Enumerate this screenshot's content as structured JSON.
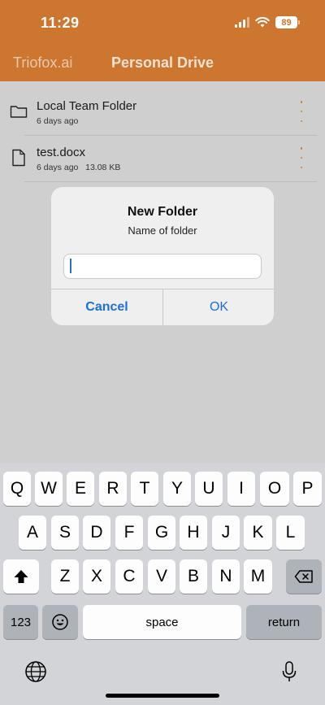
{
  "status_bar": {
    "time": "11:29",
    "battery": "89"
  },
  "nav": {
    "back_label": "Triofox.ai",
    "title": "Personal Drive"
  },
  "files": [
    {
      "name": "Local Team Folder",
      "meta": "6 days ago",
      "icon": "folder-icon"
    },
    {
      "name": "test.docx",
      "meta": "6 days ago   13.08 KB",
      "icon": "document-icon"
    }
  ],
  "dialog": {
    "title": "New Folder",
    "message": "Name of folder",
    "input_value": "",
    "cancel_label": "Cancel",
    "ok_label": "OK"
  },
  "keyboard": {
    "row1": [
      "Q",
      "W",
      "E",
      "R",
      "T",
      "Y",
      "U",
      "I",
      "O",
      "P"
    ],
    "row2": [
      "A",
      "S",
      "D",
      "F",
      "G",
      "H",
      "J",
      "K",
      "L"
    ],
    "row3": [
      "Z",
      "X",
      "C",
      "V",
      "B",
      "N",
      "M"
    ],
    "numbers_label": "123",
    "space_label": "space",
    "return_label": "return"
  },
  "colors": {
    "accent": "#cd7630",
    "dialog_button": "#1c6fd8"
  }
}
